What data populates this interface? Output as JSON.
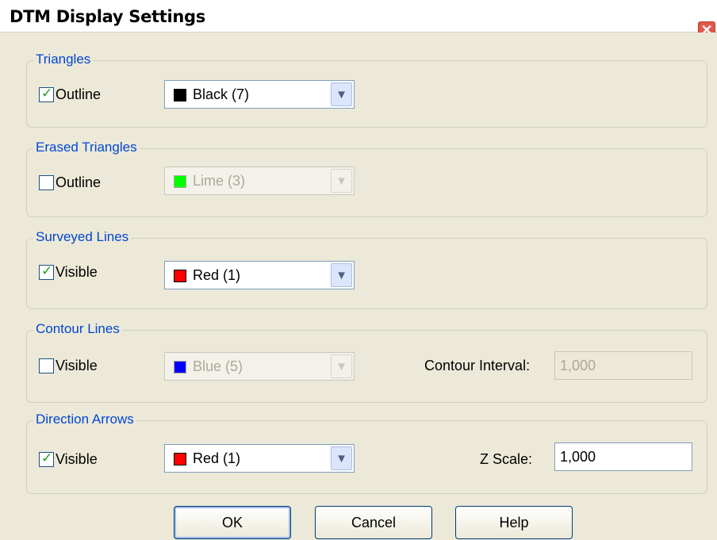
{
  "window": {
    "title": "DTM Display Settings",
    "close_glyph": "✕"
  },
  "groups": {
    "triangles": {
      "title": "Triangles",
      "checkbox_label": "Outline",
      "checked": true,
      "color_label": "Black (7)",
      "color_hex": "#000000",
      "enabled": true
    },
    "erased_triangles": {
      "title": "Erased Triangles",
      "checkbox_label": "Outline",
      "checked": false,
      "color_label": "Lime (3)",
      "color_hex": "#00ff00",
      "enabled": false
    },
    "surveyed_lines": {
      "title": "Surveyed Lines",
      "checkbox_label": "Visible",
      "checked": true,
      "color_label": "Red (1)",
      "color_hex": "#ff0000",
      "enabled": true
    },
    "contour_lines": {
      "title": "Contour Lines",
      "checkbox_label": "Visible",
      "checked": false,
      "color_label": "Blue (5)",
      "color_hex": "#0000ff",
      "enabled": false,
      "interval_label": "Contour Interval:",
      "interval_value": "1,000"
    },
    "direction_arrows": {
      "title": "Direction Arrows",
      "checkbox_label": "Visible",
      "checked": true,
      "color_label": "Red (1)",
      "color_hex": "#ff0000",
      "enabled": true,
      "zscale_label": "Z Scale:",
      "zscale_value": "1,000"
    }
  },
  "buttons": {
    "ok": "OK",
    "cancel": "Cancel",
    "help": "Help"
  },
  "icons": {
    "check": "checkmark-icon",
    "dropdown": "chevron-down-icon",
    "close": "close-icon"
  }
}
